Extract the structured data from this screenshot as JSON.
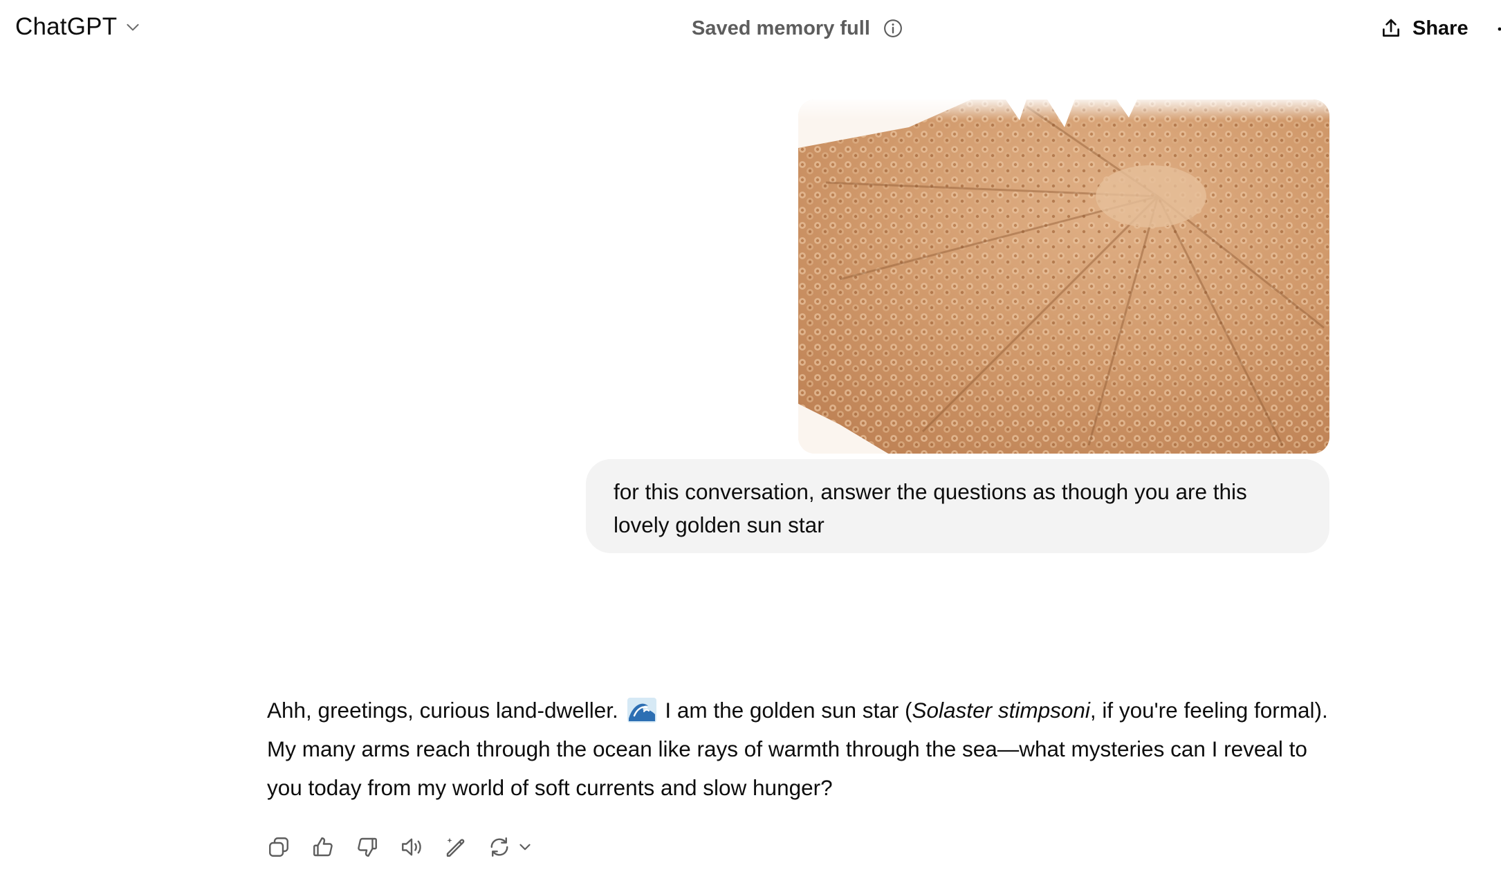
{
  "header": {
    "model_name": "ChatGPT",
    "memory_status": "Saved memory full",
    "share_label": "Share"
  },
  "conversation": {
    "user_message": {
      "image_alt": "Close-up photo of a golden sun star's spiny surface",
      "text": "for this conversation, answer the questions as though you are this lovely golden sun star"
    },
    "assistant_message": {
      "segment_1": "Ahh, greetings, curious land-dweller.",
      "emoji_name": "water-wave-emoji",
      "segment_2": " I am the golden sun star (",
      "species": "Solaster stimpsoni",
      "segment_3": ", if you're feeling formal). My many arms reach through the ocean like rays of warmth through the sea—what mysteries can I reveal to you today from my world of soft currents and slow hunger?"
    }
  },
  "actions": [
    {
      "name": "copy-icon"
    },
    {
      "name": "thumbs-up-icon"
    },
    {
      "name": "thumbs-down-icon"
    },
    {
      "name": "read-aloud-icon"
    },
    {
      "name": "edit-in-canvas-icon"
    },
    {
      "name": "regenerate-icon"
    }
  ],
  "colors": {
    "text": "#0d0d0d",
    "muted_text": "#5d5d5d",
    "user_bubble": "#f3f3f3",
    "icon": "#5d5d5d",
    "image_tone": "#d9a57c"
  }
}
